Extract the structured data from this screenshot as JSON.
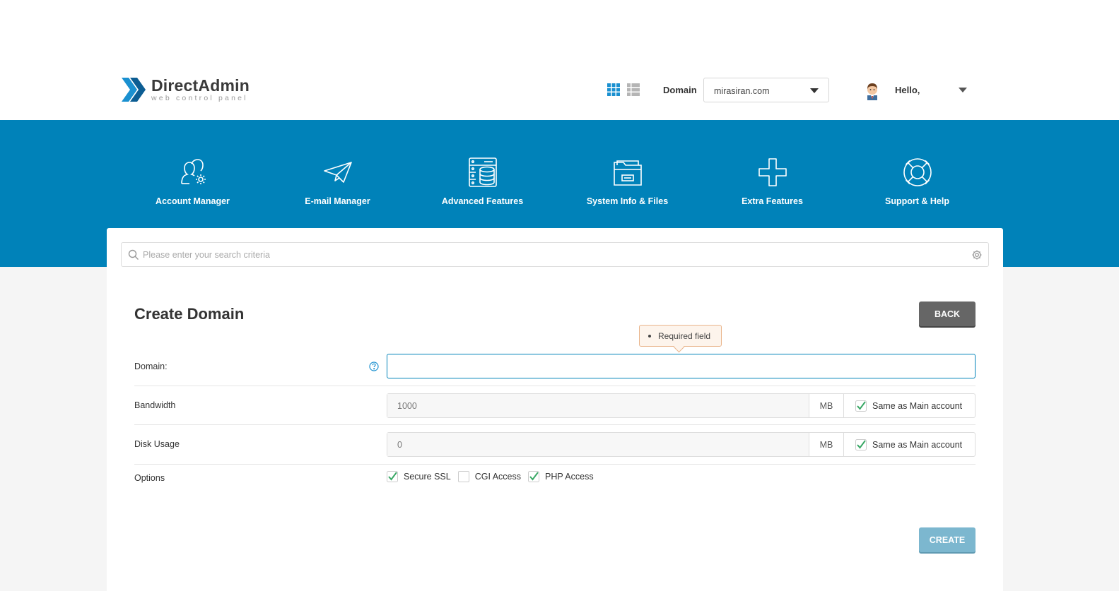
{
  "header": {
    "logo_title": "DirectAdmin",
    "logo_subtitle": "web control panel",
    "domain_label": "Domain",
    "domain_selected": "mirasiran.com",
    "greeting": "Hello,"
  },
  "nav": {
    "items": [
      {
        "label": "Account Manager",
        "icon": "users-gear-icon"
      },
      {
        "label": "E-mail Manager",
        "icon": "paper-plane-icon"
      },
      {
        "label": "Advanced Features",
        "icon": "server-database-icon"
      },
      {
        "label": "System Info & Files",
        "icon": "folder-icon"
      },
      {
        "label": "Extra Features",
        "icon": "plus-icon"
      },
      {
        "label": "Support & Help",
        "icon": "lifebuoy-icon"
      }
    ]
  },
  "search": {
    "placeholder": "Please enter your search criteria"
  },
  "form": {
    "title": "Create Domain",
    "back_label": "BACK",
    "tooltip": "Required field",
    "domain_label": "Domain:",
    "domain_value": "",
    "bandwidth_label": "Bandwidth",
    "bandwidth_value": "1000",
    "bandwidth_unit": "MB",
    "bandwidth_same": "Same as Main account",
    "disk_label": "Disk Usage",
    "disk_value": "0",
    "disk_unit": "MB",
    "disk_same": "Same as Main account",
    "options_label": "Options",
    "options": [
      {
        "label": "Secure SSL",
        "checked": true
      },
      {
        "label": "CGI Access",
        "checked": false
      },
      {
        "label": "PHP Access",
        "checked": true
      }
    ],
    "create_label": "CREATE"
  },
  "colors": {
    "brand_blue": "#0082b9",
    "check_green": "#3aa866",
    "back_button": "#666666",
    "create_button": "#7cb7cf"
  }
}
